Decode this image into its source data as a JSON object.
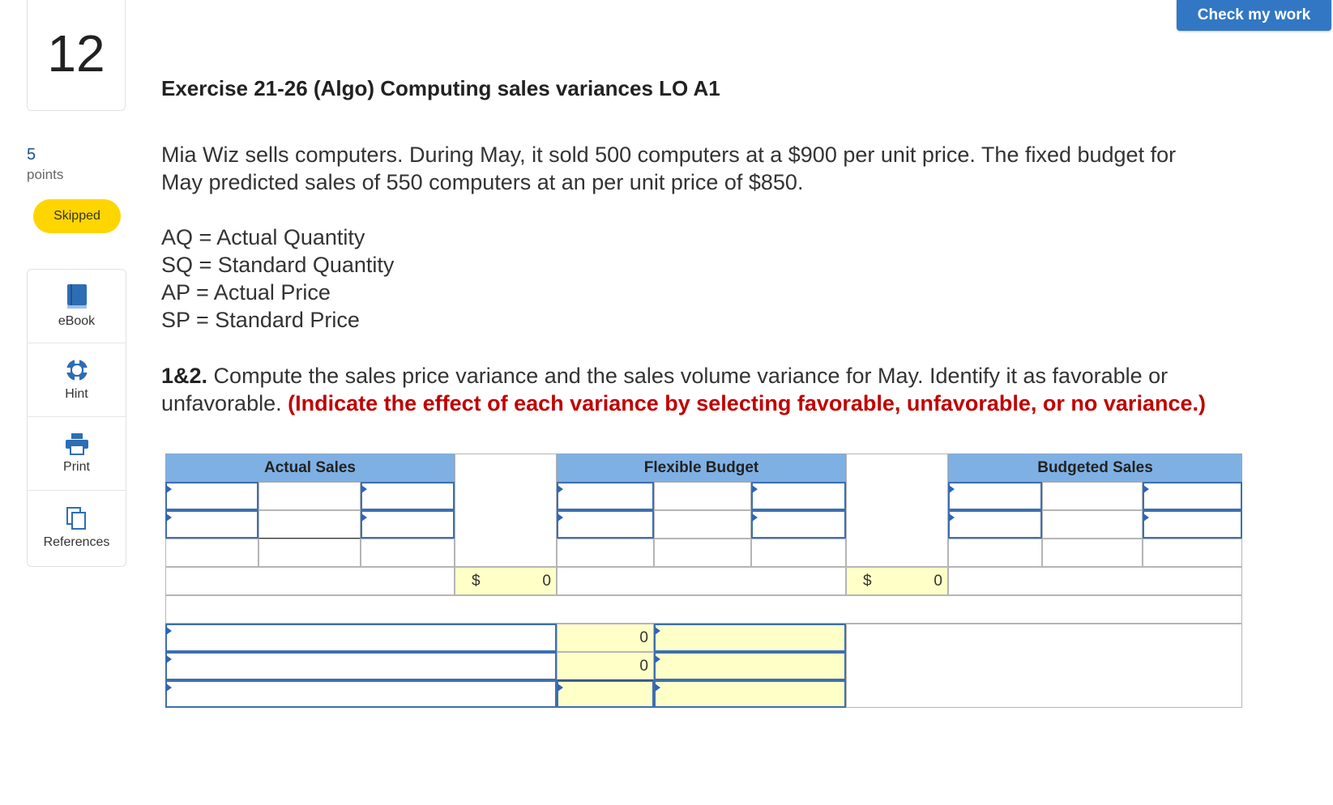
{
  "header": {
    "check_button": "Check my work"
  },
  "question": {
    "number": "12",
    "points_value": "5",
    "points_label": "points",
    "status": "Skipped"
  },
  "tools": [
    {
      "label": "eBook",
      "icon": "book-icon"
    },
    {
      "label": "Hint",
      "icon": "lifebuoy-icon"
    },
    {
      "label": "Print",
      "icon": "printer-icon"
    },
    {
      "label": "References",
      "icon": "copy-pages-icon"
    }
  ],
  "exercise": {
    "title": "Exercise 21-26 (Algo) Computing sales variances LO A1",
    "intro_line1": "Mia Wiz sells computers. During May, it sold 500 computers at a $900 per unit price. The fixed budget for",
    "intro_line2": "May predicted sales of 550 computers at an per unit price of $850.",
    "definitions": [
      "AQ = Actual Quantity",
      "SQ = Standard Quantity",
      "AP = Actual Price",
      "SP = Standard Price"
    ],
    "req_num": "1&2.",
    "req_text_line1": " Compute the sales price variance and the sales volume variance for May. Identify it as favorable or",
    "req_text_line2": "unfavorable. ",
    "req_instruction": "(Indicate the effect of each variance by selecting favorable, unfavorable, or no variance.)"
  },
  "worksheet": {
    "headers": [
      "Actual Sales",
      "Flexible Budget",
      "Budgeted Sales"
    ],
    "dollar_sign": "$",
    "variance_1": "0",
    "variance_2": "0",
    "summary_1": "0",
    "summary_2": "0",
    "colors": {
      "header": "#7fb0e3",
      "input_border": "#3d6fb0",
      "highlight": "#ffffc8"
    }
  }
}
